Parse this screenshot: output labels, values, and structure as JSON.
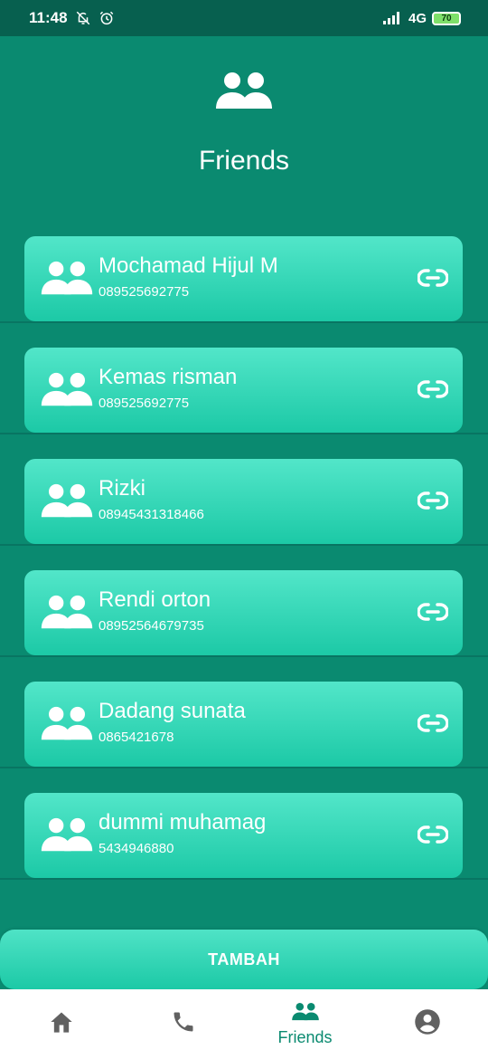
{
  "status_bar": {
    "time": "11:48",
    "network": "4G",
    "battery": "70",
    "icons": [
      "notifications-off-icon",
      "alarm-icon",
      "signal-icon",
      "battery-icon"
    ]
  },
  "header": {
    "icon": "group-icon",
    "title": "Friends"
  },
  "friends": [
    {
      "name": "Mochamad Hijul M",
      "phone": "089525692775"
    },
    {
      "name": "Kemas risman",
      "phone": "089525692775"
    },
    {
      "name": "Rizki",
      "phone": "08945431318466"
    },
    {
      "name": "Rendi orton",
      "phone": "08952564679735"
    },
    {
      "name": "Dadang sunata",
      "phone": "0865421678"
    },
    {
      "name": "dummi muhamag",
      "phone": "5434946880"
    }
  ],
  "add_button": {
    "label": "TAMBAH"
  },
  "bottom_nav": {
    "items": [
      {
        "icon": "home-icon",
        "label": ""
      },
      {
        "icon": "phone-icon",
        "label": ""
      },
      {
        "icon": "group-icon",
        "label": "Friends",
        "active": true
      },
      {
        "icon": "account-icon",
        "label": ""
      }
    ]
  },
  "colors": {
    "background": "#0a8a70",
    "status_bar": "#07604f",
    "card_top": "#52e6c9",
    "card_bottom": "#1cc9a6",
    "nav_active": "#0a8a70",
    "nav_inactive": "#616161"
  }
}
